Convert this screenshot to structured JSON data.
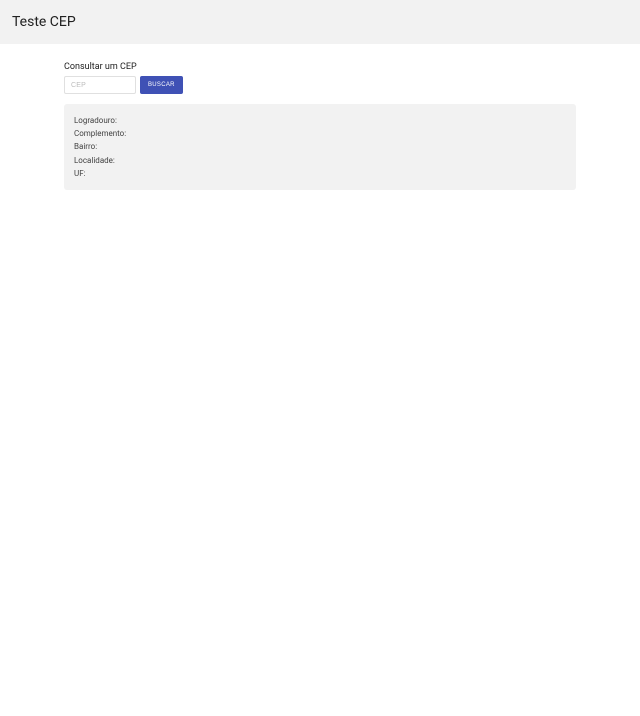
{
  "header": {
    "title": "Teste CEP"
  },
  "form": {
    "subtitle": "Consultar um CEP",
    "input_placeholder": "CEP",
    "input_value": "",
    "button_label": "BUSCAR"
  },
  "result": {
    "logradouro_label": "Logradouro:",
    "logradouro_value": "",
    "complemento_label": "Complemento:",
    "complemento_value": "",
    "bairro_label": "Bairro:",
    "bairro_value": "",
    "localidade_label": "Localidade:",
    "localidade_value": "",
    "uf_label": "UF:",
    "uf_value": ""
  }
}
